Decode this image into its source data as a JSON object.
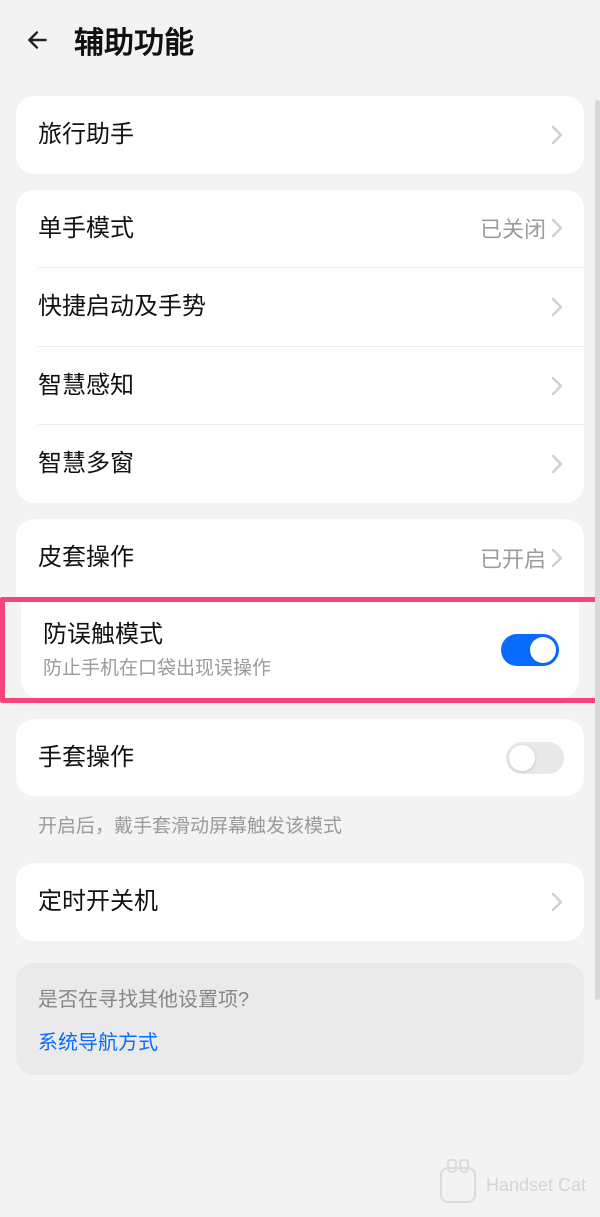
{
  "header": {
    "title": "辅助功能"
  },
  "group1": {
    "travel": "旅行助手"
  },
  "group2": {
    "onehand": {
      "label": "单手模式",
      "value": "已关闭"
    },
    "gesture": {
      "label": "快捷启动及手势"
    },
    "smart_sense": {
      "label": "智慧感知"
    },
    "smart_window": {
      "label": "智慧多窗"
    }
  },
  "group3": {
    "cover": {
      "label": "皮套操作",
      "value": "已开启"
    },
    "pocket": {
      "label": "防误触模式",
      "sub": "防止手机在口袋出现误操作",
      "on": true
    }
  },
  "group4": {
    "glove": {
      "label": "手套操作",
      "on": false
    },
    "hint": "开启后，戴手套滑动屏幕触发该模式"
  },
  "group5": {
    "power": {
      "label": "定时开关机"
    }
  },
  "footer": {
    "question": "是否在寻找其他设置项?",
    "link": "系统导航方式"
  },
  "watermark": "Handset Cat"
}
